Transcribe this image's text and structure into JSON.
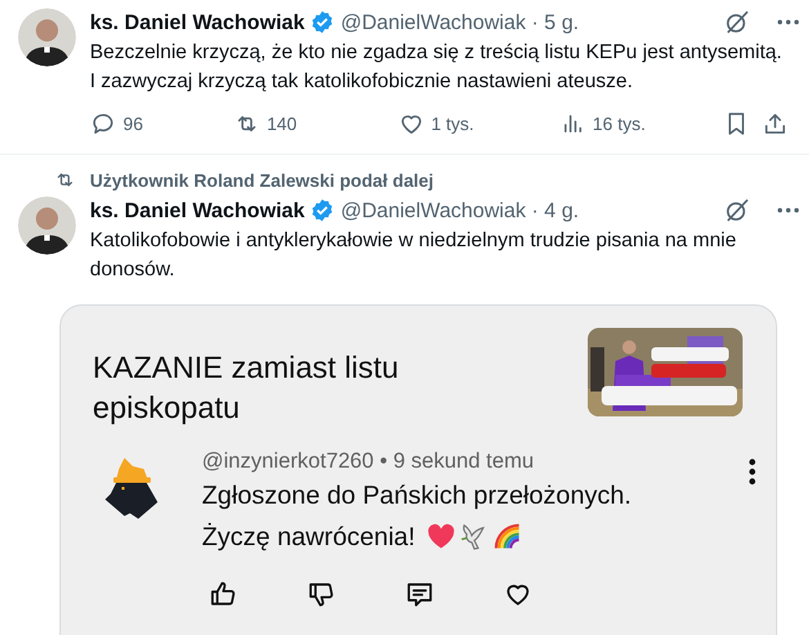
{
  "tweets": [
    {
      "author": "ks. Daniel Wachowiak",
      "verified": true,
      "handle_time": "@DanielWachowiak · 5 g.",
      "text": "Bezczelnie krzyczą, że kto nie zgadza się z treścią listu KEPu jest antysemitą. I zazwyczaj krzyczą tak katolikofobicznie nastawieni ateusze.",
      "actions": [
        {
          "kind": "reply",
          "label": "96"
        },
        {
          "kind": "retweet",
          "label": "140"
        },
        {
          "kind": "like",
          "label": "1 tys."
        },
        {
          "kind": "views",
          "label": "16 tys."
        },
        {
          "kind": "bookmark"
        },
        {
          "kind": "share"
        }
      ]
    },
    {
      "social_context": "Użytkownik Roland Zalewski podał dalej",
      "author": "ks. Daniel Wachowiak",
      "verified": true,
      "handle_time": "@DanielWachowiak · 4 g.",
      "text": "Katolikofobowie i antyklerykałowie w niedzielnym trudzie pisania na mnie donosów.",
      "card": {
        "title": "KAZANIE zamiast listu episkopatu",
        "comment": {
          "meta": "@inzynierkot7260 • 9 sekund temu",
          "lines": [
            "Zgłoszone do Pańskich przełożonych.",
            "Życzę nawrócenia!"
          ],
          "emoji": [
            {
              "kind": "heart"
            },
            {
              "kind": "dove"
            },
            {
              "kind": "rainbow"
            }
          ],
          "actions": [
            {
              "kind": "thumb-up"
            },
            {
              "kind": "thumb-down"
            },
            {
              "kind": "comment"
            },
            {
              "kind": "heart"
            }
          ]
        }
      }
    }
  ]
}
